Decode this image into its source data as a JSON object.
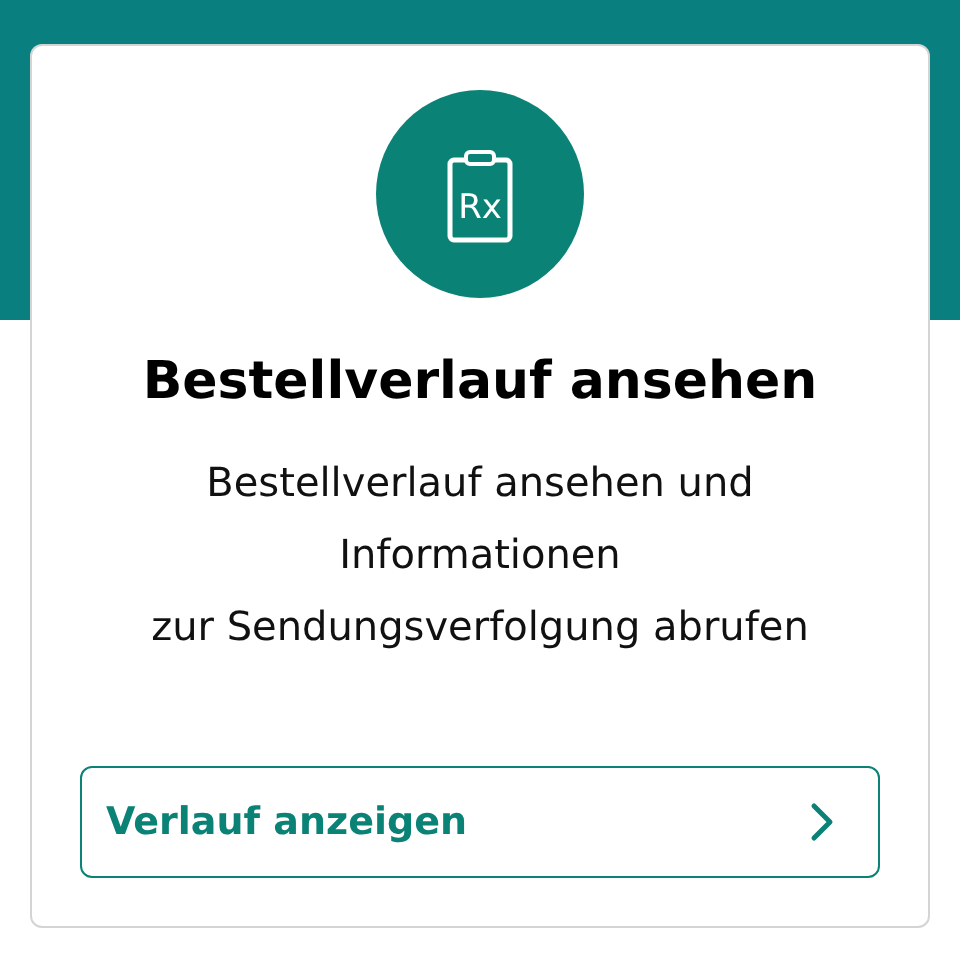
{
  "card": {
    "icon_text": "Rx",
    "title": "Bestellverlauf ansehen",
    "description_lines": [
      "Bestellverlauf ansehen und",
      "Informationen",
      "zur Sendungsverfolgung abrufen"
    ],
    "button": {
      "label": "Verlauf anzeigen"
    }
  }
}
